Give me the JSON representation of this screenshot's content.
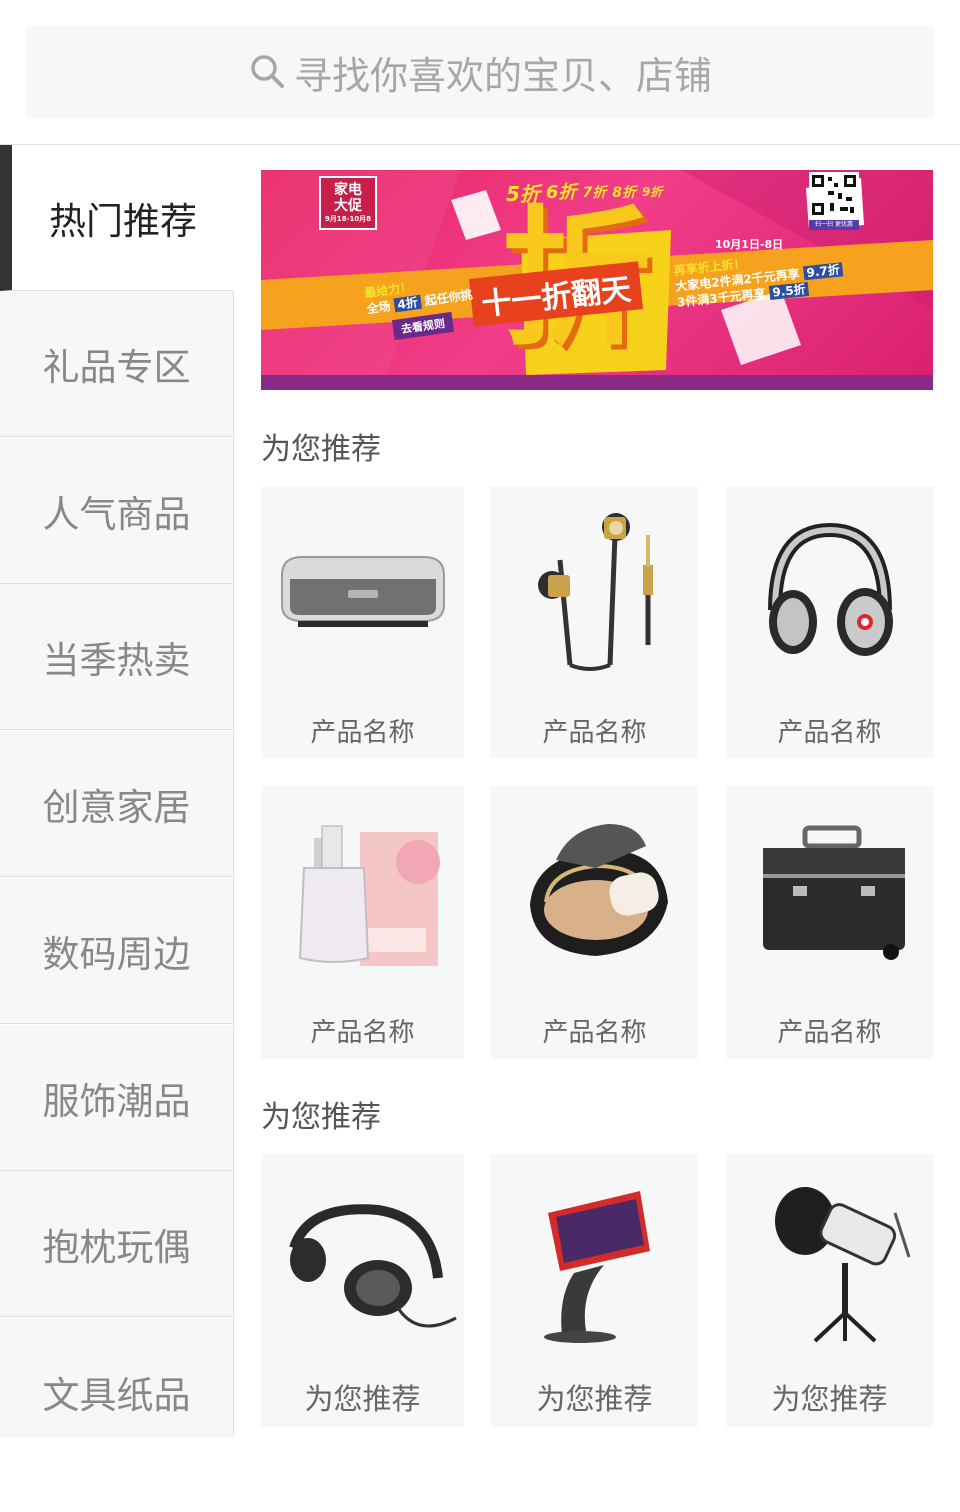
{
  "search": {
    "placeholder": "寻找你喜欢的宝贝、店铺"
  },
  "sidebar": {
    "items": [
      {
        "label": "热门推荐",
        "active": true
      },
      {
        "label": "礼品专区"
      },
      {
        "label": "人气商品"
      },
      {
        "label": "当季热卖"
      },
      {
        "label": "创意家居"
      },
      {
        "label": "数码周边"
      },
      {
        "label": "服饰潮品"
      },
      {
        "label": "抱枕玩偶"
      },
      {
        "label": "文具纸品"
      }
    ]
  },
  "banner": {
    "badge_line1": "家电",
    "badge_line2": "大促",
    "badge_dates": "9月18-10月8",
    "discounts": [
      "5折",
      "6折",
      "7折",
      "8折",
      "9折"
    ],
    "big_char": "折",
    "headline": "十一折翻天",
    "left_line1": "最给力！",
    "left_line2": "全场",
    "left_highlight": "4折",
    "left_line3": "起任你挑",
    "rules_button": "去看规则",
    "date_range": "10月1日-8日",
    "right_line1": "再享折上折！",
    "right_line2": "大家电2件满2千元再享",
    "right_badge1": "9.7折",
    "right_line3": "3件满3千元再享",
    "right_badge2": "9.5折",
    "qr_caption": "扫一扫 更优惠"
  },
  "sections": [
    {
      "title": "为您推荐",
      "products": [
        {
          "name": "产品名称",
          "icon": "speaker-icon"
        },
        {
          "name": "产品名称",
          "icon": "earphones-icon"
        },
        {
          "name": "产品名称",
          "icon": "headphones-icon"
        },
        {
          "name": "产品名称",
          "icon": "perfume-icon"
        },
        {
          "name": "产品名称",
          "icon": "compact-powder-icon"
        },
        {
          "name": "产品名称",
          "icon": "cosmetic-case-icon"
        }
      ]
    },
    {
      "title": "为您推荐",
      "products": [
        {
          "name": "为您推荐",
          "icon": "wired-headphones-icon"
        },
        {
          "name": "为您推荐",
          "icon": "kiosk-icon"
        },
        {
          "name": "为您推荐",
          "icon": "microphone-icon"
        }
      ]
    }
  ]
}
